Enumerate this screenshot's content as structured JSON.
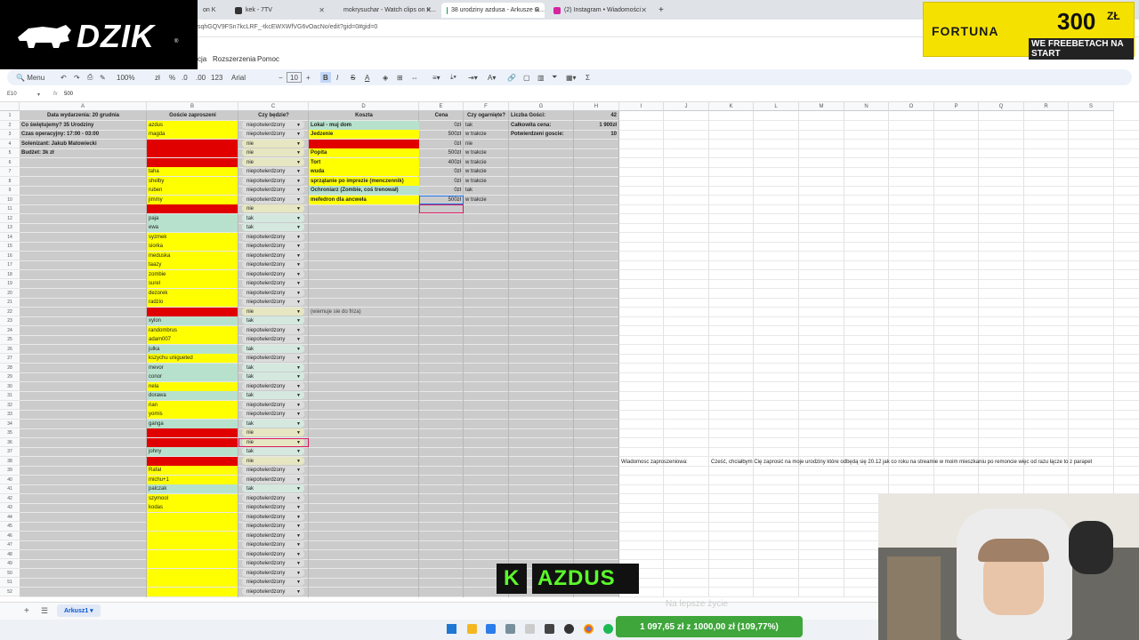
{
  "tabs": [
    {
      "label": "on K",
      "icon": "page-icon"
    },
    {
      "label": "kek - 7TV",
      "icon": "7tv-icon"
    },
    {
      "label": "mokrysuchar - Watch clips on K...",
      "icon": "kick-icon"
    },
    {
      "label": "38 urodziny azdusa - Arkusze G...",
      "icon": "sheets-icon",
      "active": true
    },
    {
      "label": "(2) Instagram • Wiadomości",
      "icon": "instagram-icon"
    }
  ],
  "url": "sqhGQV9FSn7kcLRF_-tkcEWXWfVG6vOacNo/edit?gid=0#gid=0",
  "menus": [
    "cja",
    "Rozszerzenia",
    "Pomoc"
  ],
  "toolbar": {
    "search": "Menu",
    "zoom": "100%",
    "currency": "zł",
    "percent": "%",
    "dec_down": ".0",
    "dec_up": ".00",
    "num_fmt": "123",
    "font": "Arial",
    "size": "10"
  },
  "formula": {
    "cell_ref": "E10",
    "fx": "fx",
    "value": "500"
  },
  "columns": [
    "A",
    "B",
    "C",
    "D",
    "E",
    "F",
    "G",
    "H",
    "I",
    "J",
    "K",
    "L",
    "M",
    "N",
    "O",
    "P",
    "Q",
    "R",
    "S"
  ],
  "col_a": [
    {
      "row": 1,
      "text": "Data wydarzenia: 20 grudnia",
      "bold": true,
      "center": true
    },
    {
      "row": 2,
      "text": "Co świętujemy? 35 Urodziny",
      "bold": true
    },
    {
      "row": 3,
      "text": "Czas operacyjny: 17:00 - 03:00",
      "bold": true
    },
    {
      "row": 4,
      "text": "Solenizant: Jakub Matowiecki",
      "bold": true
    },
    {
      "row": 5,
      "text": "Budżet: 3k zł",
      "bold": true
    }
  ],
  "headers": {
    "b": "Goście zaproszeni",
    "c": "Czy będzie?",
    "d": "Koszta",
    "e": "Cena",
    "f": "Czy ogarnięte?",
    "g": "Liczba Gości:",
    "h": "42"
  },
  "guests": [
    {
      "row": 2,
      "name": "azdus",
      "color": "yellow",
      "status": "niepotwierdzony"
    },
    {
      "row": 3,
      "name": "magda",
      "color": "yellow",
      "status": "niepotwierdzony"
    },
    {
      "row": 4,
      "name": "",
      "color": "red",
      "status": "nie"
    },
    {
      "row": 5,
      "name": "",
      "color": "red",
      "status": "nie"
    },
    {
      "row": 6,
      "name": "",
      "color": "red",
      "status": "nie"
    },
    {
      "row": 7,
      "name": "taha",
      "color": "yellow",
      "status": "niepotwierdzony"
    },
    {
      "row": 8,
      "name": "shelby",
      "color": "yellow",
      "status": "niepotwierdzony"
    },
    {
      "row": 9,
      "name": "ruben",
      "color": "yellow",
      "status": "niepotwierdzony"
    },
    {
      "row": 10,
      "name": "jimmy",
      "color": "yellow",
      "status": "niepotwierdzony"
    },
    {
      "row": 11,
      "name": "",
      "color": "red",
      "status": "nie"
    },
    {
      "row": 12,
      "name": "paja",
      "color": "green",
      "status": "tak"
    },
    {
      "row": 13,
      "name": "ewa",
      "color": "green",
      "status": "tak"
    },
    {
      "row": 14,
      "name": "syzmek",
      "color": "yellow",
      "status": "niepotwierdzony"
    },
    {
      "row": 15,
      "name": "siorka",
      "color": "yellow",
      "status": "niepotwierdzony"
    },
    {
      "row": 16,
      "name": "meduska",
      "color": "yellow",
      "status": "niepotwierdzony"
    },
    {
      "row": 17,
      "name": "taazy",
      "color": "yellow",
      "status": "niepotwierdzony"
    },
    {
      "row": 18,
      "name": "zombie",
      "color": "yellow",
      "status": "niepotwierdzony"
    },
    {
      "row": 19,
      "name": "surel",
      "color": "yellow",
      "status": "niepotwierdzony"
    },
    {
      "row": 20,
      "name": "dezorek",
      "color": "yellow",
      "status": "niepotwierdzony"
    },
    {
      "row": 21,
      "name": "radzio",
      "color": "yellow",
      "status": "niepotwierdzony"
    },
    {
      "row": 22,
      "name": "",
      "color": "red",
      "status": "nie"
    },
    {
      "row": 23,
      "name": "xylon",
      "color": "green",
      "status": "tak"
    },
    {
      "row": 24,
      "name": "randombrus",
      "color": "yellow",
      "status": "niepotwierdzony"
    },
    {
      "row": 25,
      "name": "adam007",
      "color": "yellow",
      "status": "niepotwierdzony"
    },
    {
      "row": 26,
      "name": "julka",
      "color": "green",
      "status": "tak"
    },
    {
      "row": 27,
      "name": "kszychu unigueted",
      "color": "yellow",
      "status": "niepotwierdzony"
    },
    {
      "row": 28,
      "name": "mevor",
      "color": "green",
      "status": "tak"
    },
    {
      "row": 29,
      "name": "conor",
      "color": "green",
      "status": "tak"
    },
    {
      "row": 30,
      "name": "nela",
      "color": "yellow",
      "status": "niepotwierdzony"
    },
    {
      "row": 31,
      "name": "dorawa",
      "color": "green",
      "status": "tak"
    },
    {
      "row": 32,
      "name": "rian",
      "color": "yellow",
      "status": "niepotwierdzony"
    },
    {
      "row": 33,
      "name": "yomis",
      "color": "yellow",
      "status": "niepotwierdzony"
    },
    {
      "row": 34,
      "name": "ganga",
      "color": "green",
      "status": "tak"
    },
    {
      "row": 35,
      "name": "",
      "color": "red",
      "status": "nie"
    },
    {
      "row": 36,
      "name": "",
      "color": "red",
      "status": "nie"
    },
    {
      "row": 37,
      "name": "johny",
      "color": "green",
      "status": "tak"
    },
    {
      "row": 38,
      "name": "",
      "color": "red",
      "status": "nie"
    },
    {
      "row": 39,
      "name": "Rafał",
      "color": "yellow",
      "status": "niepotwierdzony"
    },
    {
      "row": 40,
      "name": "michu+1",
      "color": "yellow",
      "status": "niepotwierdzony"
    },
    {
      "row": 41,
      "name": "palczak",
      "color": "green",
      "status": "tak"
    },
    {
      "row": 42,
      "name": "szymool",
      "color": "yellow",
      "status": "niepotwierdzony"
    },
    {
      "row": 43,
      "name": "kodas",
      "color": "yellow",
      "status": "niepotwierdzony"
    },
    {
      "row": 44,
      "name": "",
      "color": "yellow",
      "status": "niepotwierdzony"
    },
    {
      "row": 45,
      "name": "",
      "color": "yellow",
      "status": "niepotwierdzony"
    },
    {
      "row": 46,
      "name": "",
      "color": "yellow",
      "status": "niepotwierdzony"
    },
    {
      "row": 47,
      "name": "",
      "color": "yellow",
      "status": "niepotwierdzony"
    },
    {
      "row": 48,
      "name": "",
      "color": "yellow",
      "status": "niepotwierdzony"
    },
    {
      "row": 49,
      "name": "",
      "color": "yellow",
      "status": "niepotwierdzony"
    },
    {
      "row": 50,
      "name": "",
      "color": "yellow",
      "status": "niepotwierdzony"
    },
    {
      "row": 51,
      "name": "",
      "color": "yellow",
      "status": "niepotwierdzony"
    },
    {
      "row": 52,
      "name": "",
      "color": "yellow",
      "status": "niepotwierdzony"
    }
  ],
  "costs": [
    {
      "row": 2,
      "item": "Lokal - muj dom",
      "color": "green",
      "price": "0zł",
      "status": "tak"
    },
    {
      "row": 3,
      "item": "Jedzenie",
      "color": "yellow",
      "price": "500zł",
      "status": "w trakcie"
    },
    {
      "row": 4,
      "item": "",
      "color": "red",
      "price": "0zł",
      "status": "nie"
    },
    {
      "row": 5,
      "item": "Popita",
      "color": "yellow",
      "price": "500zł",
      "status": "w trakcie"
    },
    {
      "row": 6,
      "item": "Tort",
      "color": "yellow",
      "price": "400zł",
      "status": "w trakcie"
    },
    {
      "row": 7,
      "item": "wuda",
      "color": "yellow",
      "price": "0zł",
      "status": "w trakcie"
    },
    {
      "row": 8,
      "item": "sprzątanie po imprezie (menczennik)",
      "color": "yellow",
      "price": "0zł",
      "status": "w trakcie"
    },
    {
      "row": 9,
      "item": "Ochroniarz (Zombie, coś trenował)",
      "color": "green",
      "price": "0zł",
      "status": "tak"
    },
    {
      "row": 10,
      "item": "mefedron dla ancweła",
      "color": "yellow",
      "price": "500zł",
      "status": "w trakcie"
    }
  ],
  "stats": [
    {
      "row": 2,
      "label": "Całkowita cena:",
      "value": "1 900zł"
    },
    {
      "row": 3,
      "label": "Potwierdzeni goscie:",
      "value": "10"
    }
  ],
  "note_d22": "(wiemuje sie do friza)",
  "invite": {
    "label": "Wiadomosc zaproszeniowa:",
    "text": "Cześć, chciałbym Cię zaprosić na moje urodziny które odbędą się 20.12 jak co roku na streamie w moim mieszkaniu po remoncie więc od razu łącze to z parapet"
  },
  "sheet_tab": "Arkusz1",
  "overlays": {
    "brand": "DZIK",
    "ad_brand": "FORTUNA",
    "ad_amount": "300",
    "ad_currency": "ZŁ",
    "ad_line": "WE FREEBETACH NA START",
    "streamer_k": "K",
    "streamer_name": "AZDUS",
    "ghost_text": "Na lepsze życie",
    "donation": "1 097,65 zł  z 1000,00 zł  (109,77%)"
  },
  "colors": {
    "yellow": "#ffff00",
    "red": "#e00000",
    "green": "#b7e1cd",
    "gray": "#cbcbcb"
  }
}
